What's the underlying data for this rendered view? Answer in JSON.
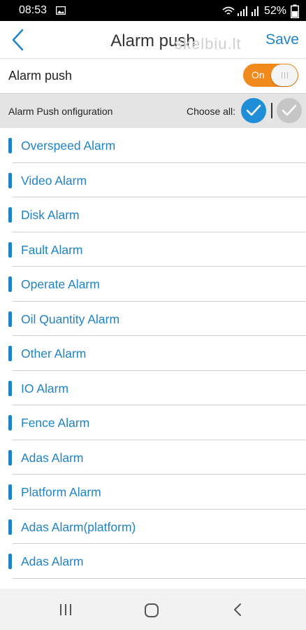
{
  "status_bar": {
    "time": "08:53",
    "battery": "52%"
  },
  "header": {
    "title": "Alarm push",
    "watermark": "skelbiu.lt",
    "save_label": "Save"
  },
  "push": {
    "label": "Alarm push",
    "toggle_text": "On",
    "toggle_state": "on"
  },
  "config": {
    "label": "Alarm Push onfiguration",
    "choose_all_label": "Choose all:"
  },
  "alarms": [
    {
      "label": "Overspeed Alarm"
    },
    {
      "label": "Video Alarm"
    },
    {
      "label": "Disk Alarm"
    },
    {
      "label": "Fault Alarm"
    },
    {
      "label": "Operate Alarm"
    },
    {
      "label": "Oil Quantity Alarm"
    },
    {
      "label": "Other Alarm"
    },
    {
      "label": "IO Alarm"
    },
    {
      "label": "Fence Alarm"
    },
    {
      "label": "Adas Alarm"
    },
    {
      "label": "Platform Alarm"
    },
    {
      "label": "Adas Alarm(platform)"
    },
    {
      "label": "Adas Alarm"
    },
    {
      "label": ""
    }
  ],
  "colors": {
    "accent": "#1f83c8",
    "toggle_on": "#f08a1c",
    "check_selected": "#1f8ed6",
    "check_unselected": "#c6c6c6"
  },
  "icons": {
    "back": "chevron-left-icon",
    "check": "checkmark-icon",
    "nav_recents": "recents-icon",
    "nav_home": "home-icon",
    "nav_back": "back-icon"
  }
}
